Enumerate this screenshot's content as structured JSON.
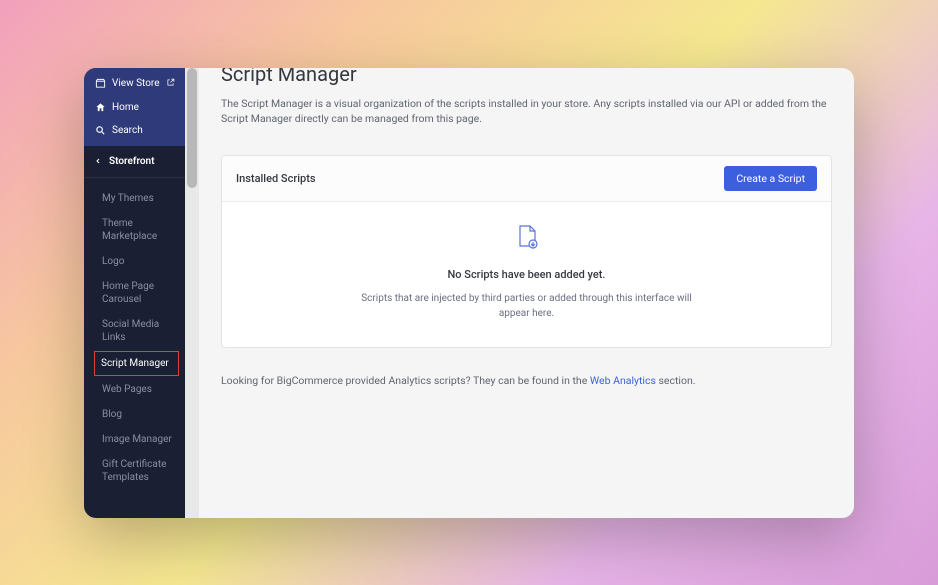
{
  "sidebar": {
    "top": {
      "view_store": "View Store",
      "home": "Home",
      "search": "Search"
    },
    "section_header": "Storefront",
    "items": [
      {
        "label": "My Themes"
      },
      {
        "label": "Theme Marketplace"
      },
      {
        "label": "Logo"
      },
      {
        "label": "Home Page Carousel"
      },
      {
        "label": "Social Media Links"
      },
      {
        "label": "Script Manager"
      },
      {
        "label": "Web Pages"
      },
      {
        "label": "Blog"
      },
      {
        "label": "Image Manager"
      },
      {
        "label": "Gift Certificate Templates"
      }
    ]
  },
  "main": {
    "title": "Script Manager",
    "description": "The Script Manager is a visual organization of the scripts installed in your store. Any scripts installed via our API or added from the Script Manager directly can be managed from this page.",
    "card": {
      "header": "Installed Scripts",
      "button": "Create a Script",
      "empty_title": "No Scripts have been added yet.",
      "empty_desc": "Scripts that are injected by third parties or added through this interface will appear here."
    },
    "footer": {
      "prefix": "Looking for BigCommerce provided Analytics scripts? They can be found in the ",
      "link": "Web Analytics",
      "suffix": " section."
    }
  }
}
